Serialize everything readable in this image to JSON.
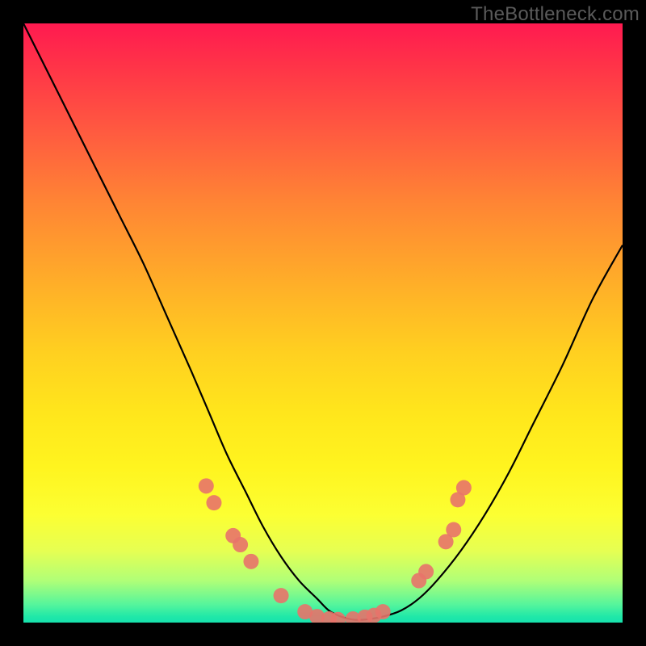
{
  "watermark": "TheBottleneck.com",
  "chart_data": {
    "type": "line",
    "title": "",
    "xlabel": "",
    "ylabel": "",
    "xlim": [
      0,
      100
    ],
    "ylim": [
      0,
      100
    ],
    "series": [
      {
        "name": "main-curve",
        "x": [
          0,
          4,
          8,
          12,
          16,
          20,
          24,
          28,
          31,
          34,
          37,
          40,
          43,
          46,
          49,
          51,
          53,
          55,
          57,
          60,
          63,
          66,
          69,
          73,
          77,
          81,
          85,
          90,
          95,
          100
        ],
        "y": [
          100,
          92,
          84,
          76,
          68,
          60,
          51,
          42,
          35,
          28,
          22,
          16,
          11,
          7,
          4,
          2,
          1,
          0.5,
          0.5,
          1,
          2,
          4,
          7,
          12,
          18,
          25,
          33,
          43,
          54,
          63
        ]
      }
    ],
    "markers": {
      "name": "highlight-dots",
      "color": "#e8736a",
      "points": [
        {
          "x": 30.5,
          "y": 22.8
        },
        {
          "x": 31.8,
          "y": 20.0
        },
        {
          "x": 35.0,
          "y": 14.5
        },
        {
          "x": 36.2,
          "y": 13.0
        },
        {
          "x": 38.0,
          "y": 10.2
        },
        {
          "x": 43.0,
          "y": 4.5
        },
        {
          "x": 47.0,
          "y": 1.8
        },
        {
          "x": 49.0,
          "y": 1.0
        },
        {
          "x": 51.0,
          "y": 0.6
        },
        {
          "x": 52.5,
          "y": 0.5
        },
        {
          "x": 55.0,
          "y": 0.6
        },
        {
          "x": 57.0,
          "y": 0.9
        },
        {
          "x": 58.5,
          "y": 1.2
        },
        {
          "x": 60.0,
          "y": 1.8
        },
        {
          "x": 66.0,
          "y": 7.0
        },
        {
          "x": 67.2,
          "y": 8.5
        },
        {
          "x": 70.5,
          "y": 13.5
        },
        {
          "x": 71.8,
          "y": 15.5
        },
        {
          "x": 72.5,
          "y": 20.5
        },
        {
          "x": 73.5,
          "y": 22.5
        }
      ]
    }
  }
}
